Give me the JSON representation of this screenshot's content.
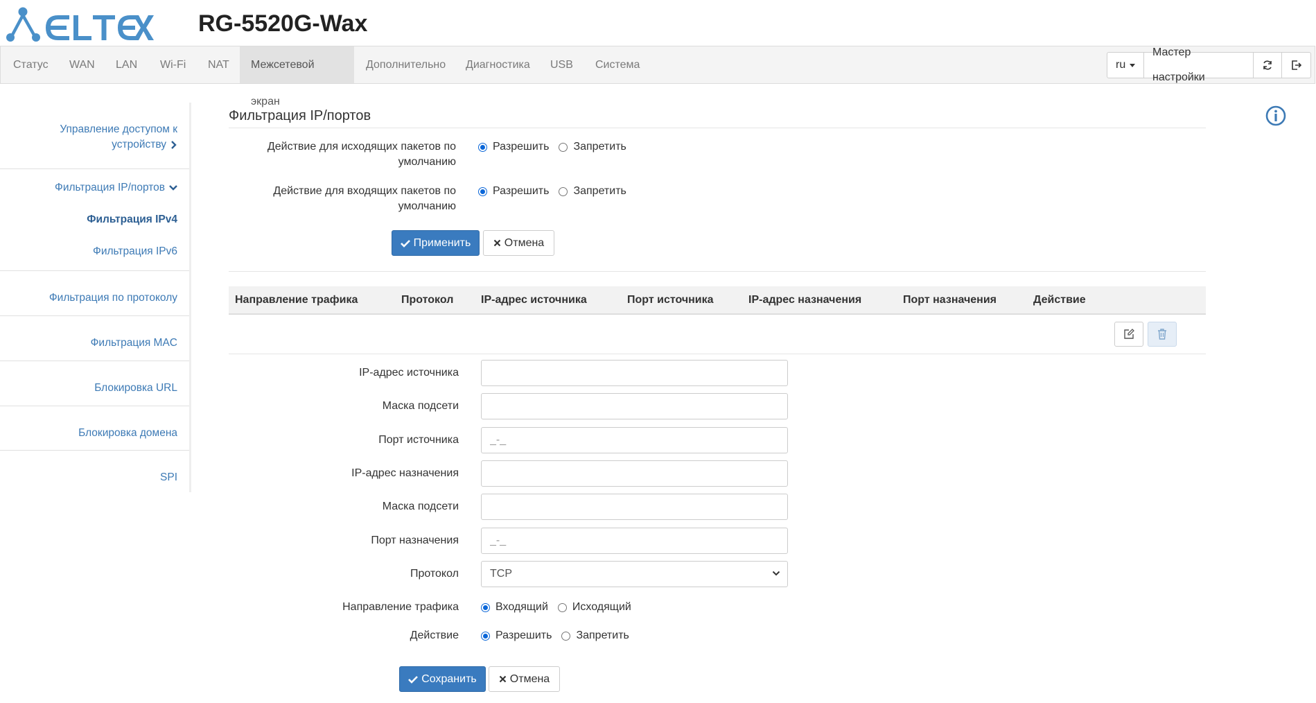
{
  "header": {
    "logo_text": "ELTEX",
    "model": "RG-5520G-Wax"
  },
  "navbar": {
    "items": [
      {
        "label": "Статус"
      },
      {
        "label": "WAN"
      },
      {
        "label": "LAN"
      },
      {
        "label": "Wi-Fi"
      },
      {
        "label": "NAT"
      },
      {
        "label": "Межсетевой экран",
        "active": true
      },
      {
        "label": "Дополнительно"
      },
      {
        "label": "Диагностика"
      },
      {
        "label": "USB"
      },
      {
        "label": "Система"
      }
    ],
    "language": "ru",
    "wizard_label": "Мастер настройки",
    "refresh_icon": "refresh-icon",
    "logout_icon": "logout-icon"
  },
  "sidebar": {
    "items": [
      {
        "label": "Управление доступом к устройству",
        "icon": "chevron-right-icon"
      },
      {
        "label": "Фильтрация IP/портов",
        "icon": "chevron-down-icon"
      },
      {
        "label": "Фильтрация IPv4",
        "current": true
      },
      {
        "label": "Фильтрация IPv6"
      },
      {
        "label": "Фильтрация по протоколу"
      },
      {
        "label": "Фильтрация MAC"
      },
      {
        "label": "Блокировка URL"
      },
      {
        "label": "Блокировка домена"
      },
      {
        "label": "SPI"
      }
    ],
    "label_line1": "Управление доступом к",
    "label_line2": "устройству"
  },
  "main": {
    "title": "Фильтрация IP/портов",
    "info_icon": "info-icon",
    "default_policy": {
      "outgoing_label_line1": "Действие для исходящих пакетов по",
      "outgoing_label_line2": "умолчанию",
      "incoming_label_line1": "Действие для входящих пакетов по",
      "incoming_label_line2": "умолчанию",
      "allow": "Разрешить",
      "deny": "Запретить",
      "outgoing_value": "Разрешить",
      "incoming_value": "Разрешить"
    },
    "apply_label": "Применить",
    "cancel_label": "Отмена",
    "table": {
      "columns": [
        "Направление трафика",
        "Протокол",
        "IP-адрес источника",
        "Порт источника",
        "IP-адрес назначения",
        "Порт назначения",
        "Действие"
      ],
      "rows": [],
      "edit_icon": "edit-icon",
      "delete_icon": "trash-icon"
    },
    "rule_form": {
      "src_ip_label": "IP-адрес источника",
      "src_ip_value": "",
      "src_mask_label": "Маска подсети",
      "src_mask_value": "",
      "src_port_label": "Порт источника",
      "src_port_placeholder": "_-_",
      "dst_ip_label": "IP-адрес назначения",
      "dst_ip_value": "",
      "dst_mask_label": "Маска подсети",
      "dst_mask_value": "",
      "dst_port_label": "Порт назначения",
      "dst_port_placeholder": "_-_",
      "protocol_label": "Протокол",
      "protocol_value": "TCP",
      "direction_label": "Направление трафика",
      "direction_in": "Входящий",
      "direction_out": "Исходящий",
      "direction_value": "Входящий",
      "action_label": "Действие",
      "action_allow": "Разрешить",
      "action_deny": "Запретить",
      "action_value": "Разрешить",
      "save_label": "Сохранить",
      "cancel_label": "Отмена"
    }
  },
  "colors": {
    "primary": "#3a7bbf",
    "link": "#3d7ab5",
    "logo": "#4a90c9",
    "navbar_bg": "#f4f4f4",
    "nav_active_bg": "#e2e2e2"
  }
}
